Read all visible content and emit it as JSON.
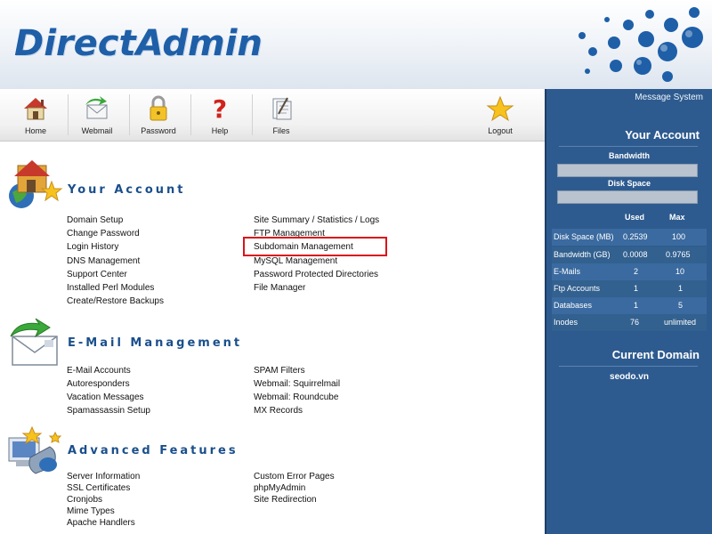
{
  "header": {
    "logo_text": "DirectAdmin"
  },
  "toolbar": {
    "items": [
      {
        "label": "Home"
      },
      {
        "label": "Webmail"
      },
      {
        "label": "Password"
      },
      {
        "label": "Help"
      },
      {
        "label": "Files"
      },
      {
        "label": "Logout"
      }
    ]
  },
  "sections": {
    "your_account": {
      "title": "Your Account",
      "left": [
        "Domain Setup",
        "Change Password",
        "Login History",
        "DNS Management",
        "Support Center",
        "Installed Perl Modules",
        "Create/Restore Backups"
      ],
      "right": [
        "Site Summary / Statistics / Logs",
        "FTP Management",
        "Subdomain Management",
        "MySQL Management",
        "Password Protected Directories",
        "File Manager"
      ]
    },
    "email": {
      "title": "E-Mail Management",
      "left": [
        "E-Mail Accounts",
        "Autoresponders",
        "Vacation Messages",
        "Spamassassin Setup"
      ],
      "right": [
        "SPAM Filters",
        "Webmail:  Squirrelmail",
        "Webmail:  Roundcube",
        "MX Records"
      ]
    },
    "advanced": {
      "title": "Advanced Features",
      "left": [
        "Server Information",
        "SSL Certificates",
        "Cronjobs",
        "Mime Types",
        "Apache Handlers"
      ],
      "right": [
        "Custom Error Pages",
        "phpMyAdmin",
        "Site Redirection"
      ]
    }
  },
  "panel": {
    "message_system": "Message System",
    "your_account_title": "Your Account",
    "bandwidth_label": "Bandwidth",
    "disk_space_label": "Disk Space",
    "col_used": "Used",
    "col_max": "Max",
    "stats": [
      {
        "name": "Disk Space (MB)",
        "used": "0.2539",
        "max": "100"
      },
      {
        "name": "Bandwidth (GB)",
        "used": "0.0008",
        "max": "0.9765"
      },
      {
        "name": "E-Mails",
        "used": "2",
        "max": "10"
      },
      {
        "name": "Ftp Accounts",
        "used": "1",
        "max": "1"
      },
      {
        "name": "Databases",
        "used": "1",
        "max": "5"
      },
      {
        "name": "Inodes",
        "used": "76",
        "max": "unlimited"
      }
    ],
    "current_domain_title": "Current Domain",
    "current_domain": "seodo.vn"
  },
  "colors": {
    "brand_blue": "#1e5fa8",
    "panel_blue": "#2e5b8f",
    "highlight_red": "#d9141b"
  }
}
